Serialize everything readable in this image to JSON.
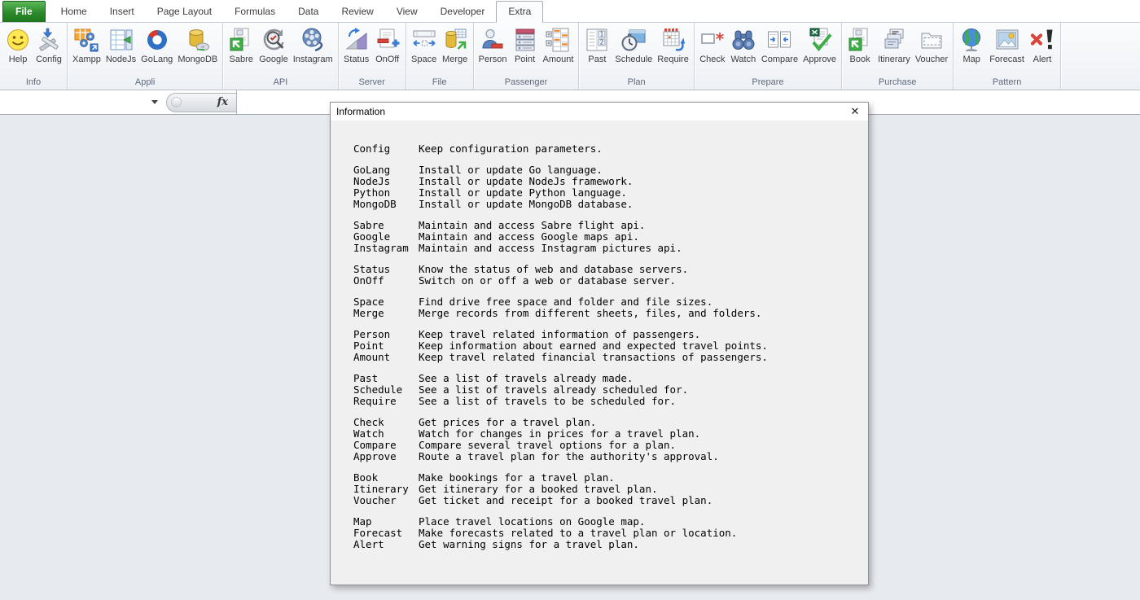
{
  "colors": {
    "file_tab_green": "#2c8a2a",
    "window_background": "#e7eaef",
    "dialog_body": "#f0f0f0",
    "ribbon_group_label": "#5f6a7a"
  },
  "ribbon": {
    "active_tab": "Extra",
    "tabs": [
      {
        "label": "File",
        "type": "file"
      },
      {
        "label": "Home",
        "type": "normal"
      },
      {
        "label": "Insert",
        "type": "normal"
      },
      {
        "label": "Page Layout",
        "type": "normal"
      },
      {
        "label": "Formulas",
        "type": "normal"
      },
      {
        "label": "Data",
        "type": "normal"
      },
      {
        "label": "Review",
        "type": "normal"
      },
      {
        "label": "View",
        "type": "normal"
      },
      {
        "label": "Developer",
        "type": "normal"
      },
      {
        "label": "Extra",
        "type": "active"
      }
    ],
    "groups": [
      {
        "label": "Info",
        "buttons": [
          {
            "label": "Help",
            "icon": "help"
          },
          {
            "label": "Config",
            "icon": "config"
          }
        ]
      },
      {
        "label": "Appli",
        "buttons": [
          {
            "label": "Xampp",
            "icon": "xampp"
          },
          {
            "label": "NodeJs",
            "icon": "nodejs"
          },
          {
            "label": "GoLang",
            "icon": "golang"
          },
          {
            "label": "MongoDB",
            "icon": "mongodb"
          }
        ]
      },
      {
        "label": "API",
        "buttons": [
          {
            "label": "Sabre",
            "icon": "sabre"
          },
          {
            "label": "Google",
            "icon": "google"
          },
          {
            "label": "Instagram",
            "icon": "instagram"
          }
        ]
      },
      {
        "label": "Server",
        "buttons": [
          {
            "label": "Status",
            "icon": "status"
          },
          {
            "label": "OnOff",
            "icon": "onoff"
          }
        ]
      },
      {
        "label": "File",
        "buttons": [
          {
            "label": "Space",
            "icon": "space"
          },
          {
            "label": "Merge",
            "icon": "merge"
          }
        ]
      },
      {
        "label": "Passenger",
        "buttons": [
          {
            "label": "Person",
            "icon": "person"
          },
          {
            "label": "Point",
            "icon": "point"
          },
          {
            "label": "Amount",
            "icon": "amount"
          }
        ]
      },
      {
        "label": "Plan",
        "buttons": [
          {
            "label": "Past",
            "icon": "past"
          },
          {
            "label": "Schedule",
            "icon": "schedule"
          },
          {
            "label": "Require",
            "icon": "require"
          }
        ]
      },
      {
        "label": "Prepare",
        "buttons": [
          {
            "label": "Check",
            "icon": "check"
          },
          {
            "label": "Watch",
            "icon": "watch"
          },
          {
            "label": "Compare",
            "icon": "compare"
          },
          {
            "label": "Approve",
            "icon": "approve"
          }
        ]
      },
      {
        "label": "Purchase",
        "buttons": [
          {
            "label": "Book",
            "icon": "book"
          },
          {
            "label": "Itinerary",
            "icon": "itinerary"
          },
          {
            "label": "Voucher",
            "icon": "voucher"
          }
        ]
      },
      {
        "label": "Pattern",
        "buttons": [
          {
            "label": "Map",
            "icon": "map"
          },
          {
            "label": "Forecast",
            "icon": "forecast"
          },
          {
            "label": "Alert",
            "icon": "alert"
          }
        ]
      }
    ]
  },
  "formula_bar": {
    "name_box_value": "",
    "formula_value": "",
    "fx_label": "fx"
  },
  "dialog": {
    "title": "Information",
    "close_label": "✕",
    "sections": [
      [
        {
          "name": "Config",
          "desc": "Keep configuration parameters."
        }
      ],
      [
        {
          "name": "GoLang",
          "desc": "Install or update Go language."
        },
        {
          "name": "NodeJs",
          "desc": "Install or update NodeJs framework."
        },
        {
          "name": "Python",
          "desc": "Install or update Python language."
        },
        {
          "name": "MongoDB",
          "desc": "Install or update MongoDB database."
        }
      ],
      [
        {
          "name": "Sabre",
          "desc": "Maintain and access Sabre flight api."
        },
        {
          "name": "Google",
          "desc": "Maintain and access Google maps api."
        },
        {
          "name": "Instagram",
          "desc": "Maintain and access Instagram pictures api."
        }
      ],
      [
        {
          "name": "Status",
          "desc": "Know the status of web and database servers."
        },
        {
          "name": "OnOff",
          "desc": "Switch on or off a web or database server."
        }
      ],
      [
        {
          "name": "Space",
          "desc": "Find drive free space and folder and file sizes."
        },
        {
          "name": "Merge",
          "desc": "Merge records from different sheets, files, and folders."
        }
      ],
      [
        {
          "name": "Person",
          "desc": "Keep travel related information of passengers."
        },
        {
          "name": "Point",
          "desc": "Keep information about earned and expected travel points."
        },
        {
          "name": "Amount",
          "desc": "Keep travel related financial transactions of passengers."
        }
      ],
      [
        {
          "name": "Past",
          "desc": "See a list of travels already made."
        },
        {
          "name": "Schedule",
          "desc": "See a list of travels already scheduled for."
        },
        {
          "name": "Require",
          "desc": "See a list of travels to be scheduled for."
        }
      ],
      [
        {
          "name": "Check",
          "desc": "Get prices for a travel plan."
        },
        {
          "name": "Watch",
          "desc": "Watch for changes in prices for a travel plan."
        },
        {
          "name": "Compare",
          "desc": "Compare several travel options for a plan."
        },
        {
          "name": "Approve",
          "desc": "Route a travel plan for the authority's approval."
        }
      ],
      [
        {
          "name": "Book",
          "desc": "Make bookings for a travel plan."
        },
        {
          "name": "Itinerary",
          "desc": "Get itinerary for a booked travel plan."
        },
        {
          "name": "Voucher",
          "desc": "Get ticket and receipt for a booked travel plan."
        }
      ],
      [
        {
          "name": "Map",
          "desc": "Place travel locations on Google map."
        },
        {
          "name": "Forecast",
          "desc": "Make forecasts related to a travel plan or location."
        },
        {
          "name": "Alert",
          "desc": "Get warning signs for a travel plan."
        }
      ]
    ]
  }
}
